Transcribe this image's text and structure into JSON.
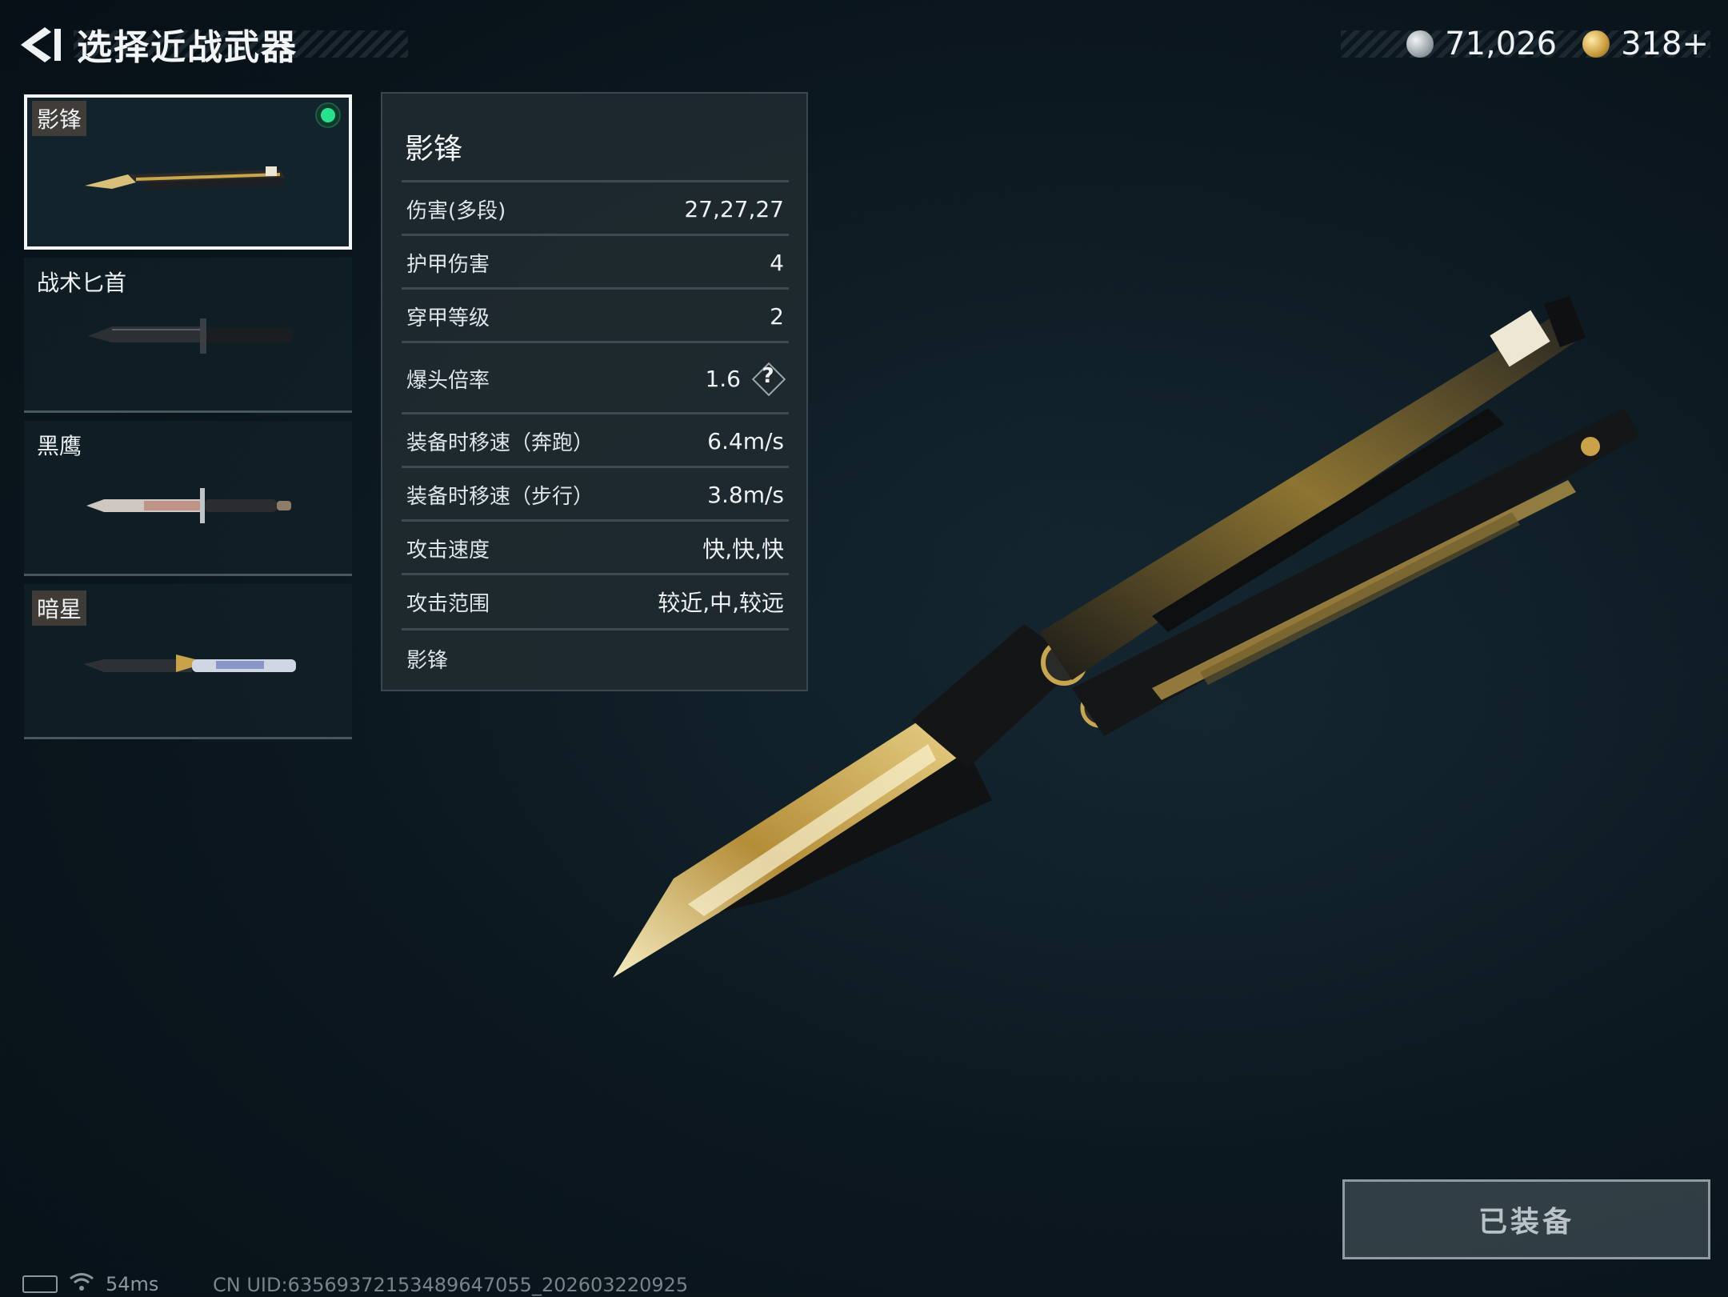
{
  "header": {
    "title": "选择近战武器",
    "silver_amount": "71,026",
    "gold_amount": "318+"
  },
  "weapons": [
    {
      "name": "影锋",
      "equipped": true
    },
    {
      "name": "战术匕首",
      "equipped": false
    },
    {
      "name": "黑鹰",
      "equipped": false
    },
    {
      "name": "暗星",
      "equipped": false
    }
  ],
  "stats": {
    "title": "影锋",
    "rows": [
      {
        "label": "伤害(多段)",
        "value": "27,27,27"
      },
      {
        "label": "护甲伤害",
        "value": "4"
      },
      {
        "label": "穿甲等级",
        "value": "2"
      },
      {
        "label": "爆头倍率",
        "value": "1.6"
      },
      {
        "label": "装备时移速（奔跑）",
        "value": "6.4m/s"
      },
      {
        "label": "装备时移速（步行）",
        "value": "3.8m/s"
      },
      {
        "label": "攻击速度",
        "value": "快,快,快"
      },
      {
        "label": "攻击范围",
        "value": "较近,中,较远"
      }
    ],
    "footer": "影锋",
    "help_symbol": "?"
  },
  "equip_button": {
    "label": "已装备"
  },
  "status_bar": {
    "ping": "54ms",
    "uid": "CN UID:63569372153489647055_202603220925"
  },
  "colors": {
    "accent_green": "#27e38d",
    "panel_bg": "#202a30",
    "gold": "#c9a24a"
  }
}
